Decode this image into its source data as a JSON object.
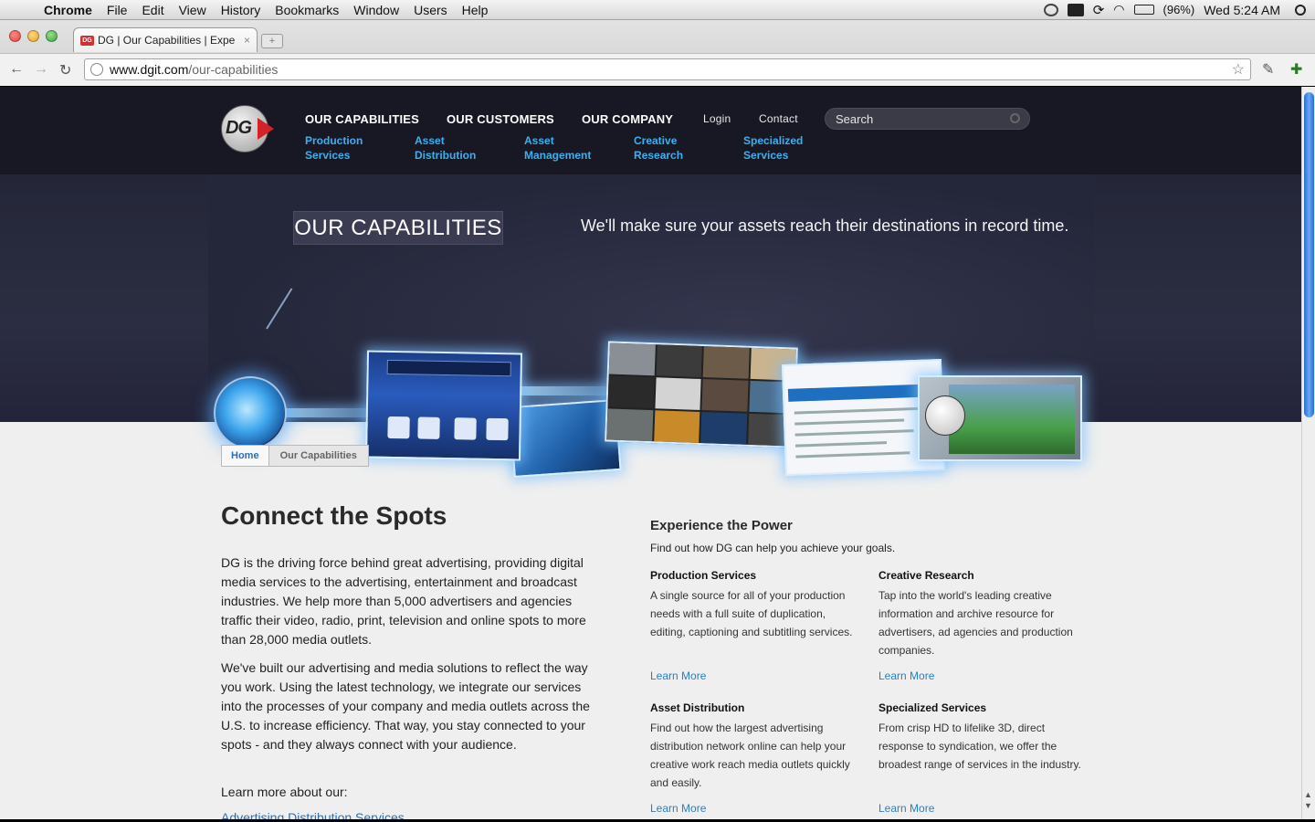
{
  "menubar": {
    "app_name": "Chrome",
    "items": [
      "File",
      "Edit",
      "View",
      "History",
      "Bookmarks",
      "Window",
      "Users",
      "Help"
    ],
    "battery": "(96%)",
    "clock": "Wed 5:24 AM"
  },
  "browser": {
    "tab_title": "DG | Our Capabilities | Expe",
    "tab_favicon": "DG",
    "url_host": "www.dgit.com",
    "url_path": "/our-capabilities"
  },
  "header": {
    "logo_text": "DG",
    "nav": [
      "OUR CAPABILITIES",
      "OUR CUSTOMERS",
      "OUR COMPANY"
    ],
    "login": "Login",
    "contact": "Contact",
    "search_placeholder": "Search",
    "subnav": [
      [
        "Production",
        "Services"
      ],
      [
        "Asset",
        "Distribution"
      ],
      [
        "Asset",
        "Management"
      ],
      [
        "Creative",
        "Research"
      ],
      [
        "Specialized",
        "Services"
      ]
    ]
  },
  "banner": {
    "title": "OUR CAPABILITIES",
    "tagline": "We'll make sure your assets reach their destinations in record time."
  },
  "breadcrumb": {
    "home": "Home",
    "current": "Our Capabilities"
  },
  "main": {
    "heading": "Connect the Spots",
    "paragraphs": [
      "DG is the driving force behind great advertising, providing digital media services to the advertising, entertainment and broadcast industries. We help more than 5,000 advertisers and agencies traffic their video, radio, print, television and online spots to more than 28,000 media outlets.",
      "We've built our advertising and media solutions to reflect the way you work. Using the latest technology, we integrate our services into the processes of your company and media outlets across the U.S. to increase efficiency. That way, you stay connected to your spots - and they always connect with your audience.",
      "Learn more about our:"
    ],
    "cut_link": "Advertising Distribution Services"
  },
  "side": {
    "heading": "Experience the Power",
    "subheading": "Find out how DG can help you achieve your goals.",
    "services": [
      {
        "title": "Production Services",
        "desc": "A single source for all of your production needs with a full suite of duplication, editing, captioning and subtitling services.",
        "link": "Learn More"
      },
      {
        "title": "Creative Research",
        "desc": "Tap into the world's leading creative information and archive resource for advertisers, ad agencies and production companies.",
        "link": "Learn More"
      },
      {
        "title": "Asset Distribution",
        "desc": "Find out how the largest advertising distribution network online can help your creative work reach media outlets quickly and easily.",
        "link": "Learn More"
      },
      {
        "title": "Specialized Services",
        "desc": "From crisp HD to lifelike 3D, direct response to syndication, we offer the broadest range of services in the industry.",
        "link": "Learn More"
      }
    ]
  }
}
